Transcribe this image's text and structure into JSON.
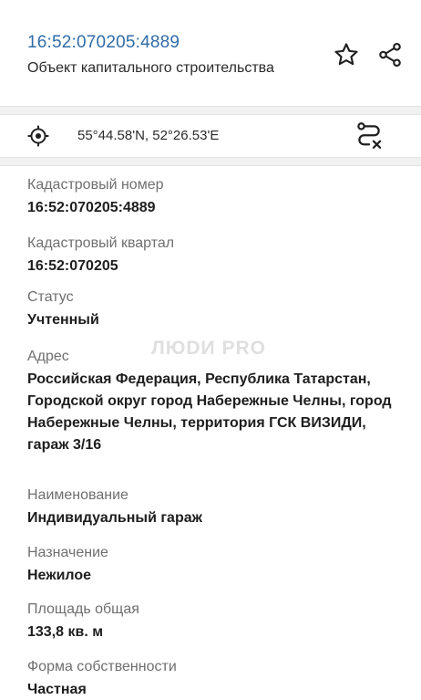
{
  "header": {
    "cadastral_number": "16:52:070205:4889",
    "object_type": "Объект капитального строительства",
    "star_icon": "star-outline-icon",
    "share_icon": "share-icon"
  },
  "location": {
    "coordinates": "55°44.58'N, 52°26.53'E",
    "target_icon": "crosshair-target-icon",
    "route_icon": "route-cancel-icon"
  },
  "fields": [
    {
      "label": "Кадастровый номер",
      "value": "16:52:070205:4889"
    },
    {
      "label": "Кадастровый квартал",
      "value": "16:52:070205"
    },
    {
      "label": "Статус",
      "value": "Учтенный"
    },
    {
      "label": "Адрес",
      "value": "Российская Федерация, Республика Татарстан, Городской округ город Набережные Челны, город Набережные Челны, территория ГСК ВИЗИДИ, гараж 3/16"
    },
    {
      "label": "Наименование",
      "value": "Индивидуальный гараж"
    },
    {
      "label": "Назначение",
      "value": "Нежилое"
    },
    {
      "label": "Площадь общая",
      "value": "133,8 кв. м"
    },
    {
      "label": "Форма собственности",
      "value": "Частная"
    }
  ],
  "watermark": "ЛЮDИ PRO",
  "colors": {
    "accent": "#2f6ca8",
    "label": "#6f6f6f",
    "value": "#1e1e1e",
    "separator": "#f1f1f1"
  }
}
